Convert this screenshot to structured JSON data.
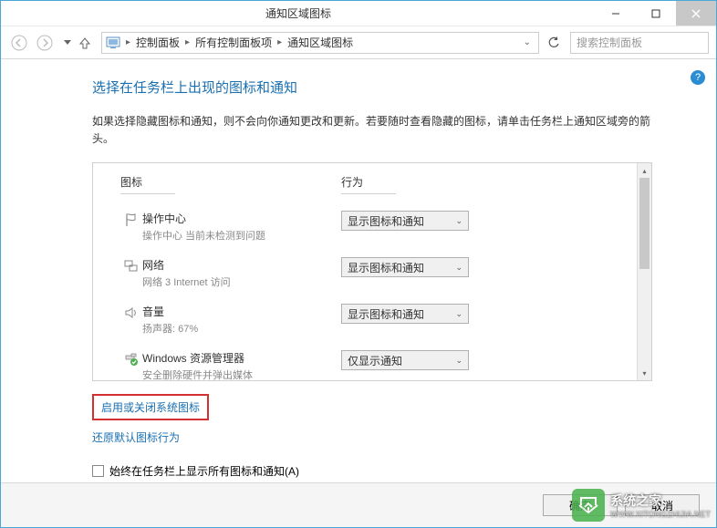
{
  "window": {
    "title": "通知区域图标"
  },
  "breadcrumb": {
    "items": [
      "控制面板",
      "所有控制面板项",
      "通知区域图标"
    ]
  },
  "search": {
    "placeholder": "搜索控制面板"
  },
  "page": {
    "title": "选择在任务栏上出现的图标和通知",
    "description": "如果选择隐藏图标和通知，则不会向你通知更改和更新。若要随时查看隐藏的图标，请单击任务栏上通知区域旁的箭头。"
  },
  "list": {
    "header_icon": "图标",
    "header_behavior": "行为",
    "rows": [
      {
        "name": "操作中心",
        "sub": "操作中心  当前未检测到问题",
        "behavior": "显示图标和通知"
      },
      {
        "name": "网络",
        "sub": "网络  3 Internet 访问",
        "behavior": "显示图标和通知"
      },
      {
        "name": "音量",
        "sub": "扬声器: 67%",
        "behavior": "显示图标和通知"
      },
      {
        "name": "Windows 资源管理器",
        "sub": "安全删除硬件并弹出媒体",
        "behavior": "仅显示通知"
      }
    ]
  },
  "links": {
    "system_icons": "启用或关闭系统图标",
    "restore_defaults": "还原默认图标行为"
  },
  "checkbox": {
    "label": "始终在任务栏上显示所有图标和通知(A)"
  },
  "footer": {
    "ok": "确定",
    "cancel": "取消"
  },
  "watermark": {
    "text": "系统之家",
    "sub": "WWW.XITONGZHIJIA.NET"
  }
}
